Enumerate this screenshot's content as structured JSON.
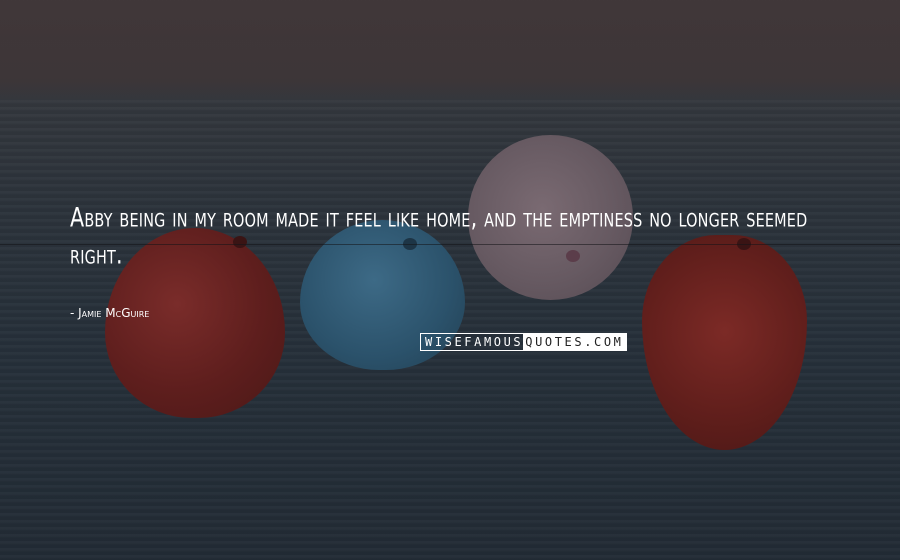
{
  "quote": {
    "text": "Abby being in my room made it feel like home, and the emptiness no longer seemed right.",
    "author": "- Jamie McGuire"
  },
  "watermark": {
    "left_text": "WISEFAMOUS",
    "right_text": "QUOTES.COM"
  },
  "background": {
    "description_colors": {
      "sea": "#26303a",
      "sky": "#3a3436",
      "balloon_red": "#621f1c",
      "balloon_blue": "#2b526b",
      "balloon_pink": "#675a62"
    }
  }
}
